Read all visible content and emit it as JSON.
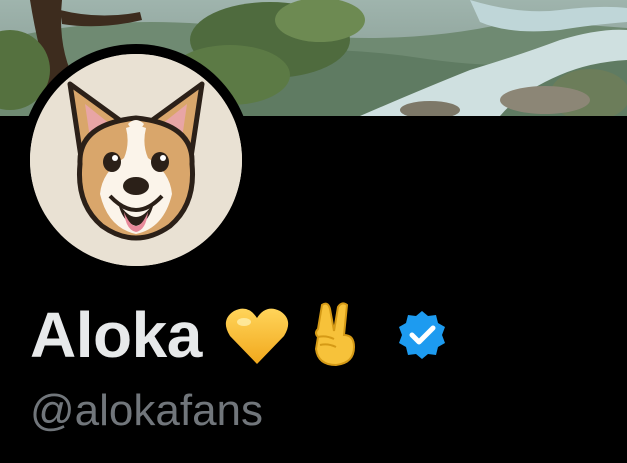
{
  "profile": {
    "display_name": "Aloka",
    "handle": "@alokafans",
    "badges": [
      "yellow-heart-icon",
      "victory-hand-icon",
      "verified-badge-icon"
    ]
  },
  "colors": {
    "background": "#000000",
    "name": "#e7e9ea",
    "handle": "#71767b",
    "verified": "#1d9bf0"
  }
}
